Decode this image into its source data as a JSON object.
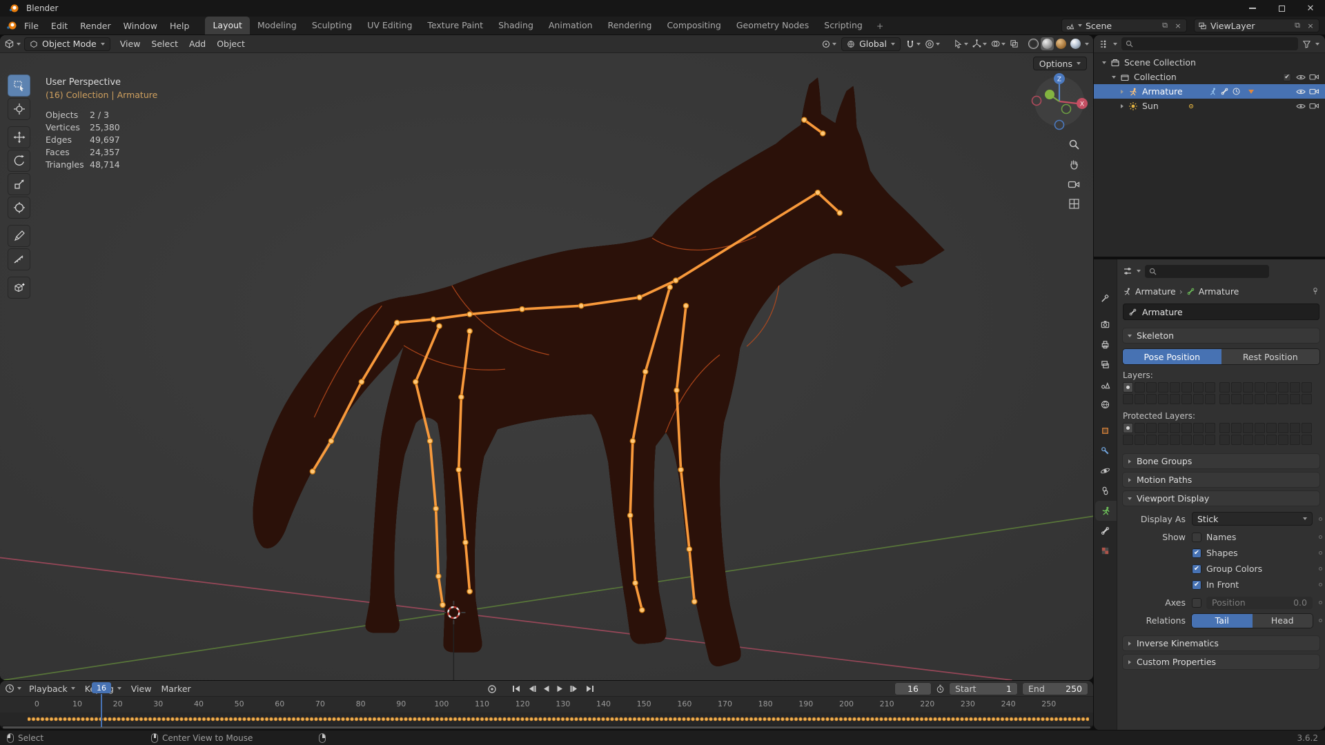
{
  "window": {
    "title": "Blender"
  },
  "colors": {
    "accent_blue": "#4772b3",
    "blender_orange": "#e87d0d",
    "bone_orange": "#ffa240",
    "wireframe_orange": "#b2451c",
    "keyframe_yellow": "#dd8f2e"
  },
  "glyphs": {
    "check": "✔"
  },
  "topbar": {
    "menus": [
      "File",
      "Edit",
      "Render",
      "Window",
      "Help"
    ],
    "workspaces": [
      "Layout",
      "Modeling",
      "Sculpting",
      "UV Editing",
      "Texture Paint",
      "Shading",
      "Animation",
      "Rendering",
      "Compositing",
      "Geometry Nodes",
      "Scripting"
    ],
    "add_workspace": "+",
    "scene": "Scene",
    "viewlayer": "ViewLayer"
  },
  "viewport": {
    "header": {
      "mode": "Object Mode",
      "menus": [
        "View",
        "Select",
        "Add",
        "Object"
      ],
      "orientation": "Global",
      "options_label": "Options"
    },
    "overlay": {
      "perspective": "User Perspective",
      "context": "(16) Collection | Armature",
      "stats": [
        {
          "label": "Objects",
          "value": "2 / 3"
        },
        {
          "label": "Vertices",
          "value": "25,380"
        },
        {
          "label": "Edges",
          "value": "49,697"
        },
        {
          "label": "Faces",
          "value": "24,357"
        },
        {
          "label": "Triangles",
          "value": "48,714"
        }
      ]
    },
    "gizmo": {
      "z": "Z",
      "x": "X"
    }
  },
  "outliner": {
    "rows": [
      {
        "label": "Scene Collection"
      },
      {
        "label": "Collection"
      },
      {
        "label": "Armature",
        "selected": true
      },
      {
        "label": "Sun"
      }
    ]
  },
  "properties": {
    "breadcrumb": {
      "a": "Armature",
      "sep": "›",
      "b": "Armature"
    },
    "name": "Armature",
    "skeleton": {
      "title": "Skeleton",
      "pose_position": "Pose Position",
      "rest_position": "Rest Position",
      "layers_label": "Layers:",
      "protected_layers_label": "Protected Layers:"
    },
    "panels": {
      "bone_groups": "Bone Groups",
      "motion_paths": "Motion Paths",
      "viewport_display": "Viewport Display",
      "inverse_kinematics": "Inverse Kinematics",
      "custom_properties": "Custom Properties"
    },
    "viewport_display": {
      "display_as_label": "Display As",
      "display_as_value": "Stick",
      "show_label": "Show",
      "names": "Names",
      "names_checked": false,
      "shapes": "Shapes",
      "shapes_checked": true,
      "group_colors": "Group Colors",
      "group_colors_checked": true,
      "in_front": "In Front",
      "in_front_checked": true,
      "axes_label": "Axes",
      "axes_checked": false,
      "position_label": "Position",
      "position_value": "0.0",
      "relations_label": "Relations",
      "tail": "Tail",
      "head": "Head"
    }
  },
  "timeline": {
    "menus": [
      "Playback",
      "Keying",
      "View",
      "Marker"
    ],
    "current_frame": "16",
    "marker_label": "16",
    "start_label": "Start",
    "start_value": "1",
    "end_label": "End",
    "end_value": "250",
    "ticks": [
      "0",
      "10",
      "20",
      "30",
      "40",
      "50",
      "60",
      "70",
      "80",
      "90",
      "100",
      "110",
      "120",
      "130",
      "140",
      "150",
      "160",
      "170",
      "180",
      "190",
      "200",
      "210",
      "220",
      "230",
      "240",
      "250"
    ]
  },
  "statusbar": {
    "select": "Select",
    "center_view": "Center View to Mouse",
    "version": "3.6.2"
  }
}
